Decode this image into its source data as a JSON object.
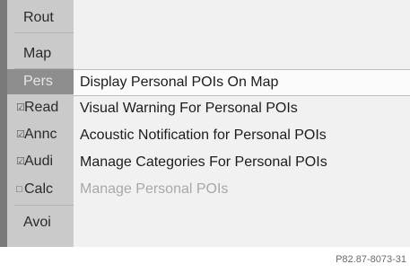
{
  "left_menu": [
    {
      "label": "Rout",
      "mark": "",
      "selected": false
    },
    {
      "label": "Map",
      "mark": "",
      "selected": false
    },
    {
      "label": "Pers",
      "mark": "",
      "selected": true
    },
    {
      "label": "Read",
      "mark": "☑",
      "selected": false
    },
    {
      "label": "Annc",
      "mark": "☑",
      "selected": false
    },
    {
      "label": "Audi",
      "mark": "☑",
      "selected": false
    },
    {
      "label": "Calc",
      "mark": "□",
      "selected": false
    },
    {
      "label": "Avoi",
      "mark": "",
      "selected": false
    }
  ],
  "submenu": [
    {
      "label": "Display Personal POIs On Map",
      "state": "highlighted"
    },
    {
      "label": "Visual Warning For Personal POIs",
      "state": "normal"
    },
    {
      "label": "Acoustic Notification for Personal POIs",
      "state": "normal"
    },
    {
      "label": "Manage Categories For Personal POIs",
      "state": "normal"
    },
    {
      "label": "Manage Personal POIs",
      "state": "disabled"
    }
  ],
  "caption": "P82.87-8073-31"
}
